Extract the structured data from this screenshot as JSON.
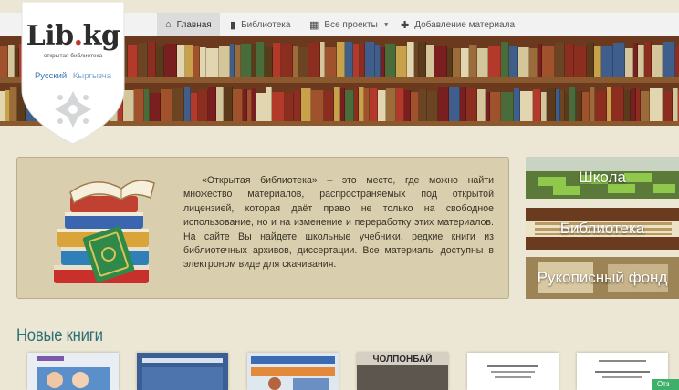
{
  "nav": {
    "home": "Главная",
    "library": "Библиотека",
    "projects": "Все проекты",
    "add": "Добавление материала"
  },
  "logo": {
    "name_a": "Lib",
    "name_dot": ".",
    "name_b": "kg",
    "subtitle": "открытая библиотека",
    "lang_ru": "Русский",
    "lang_ky": "Кыргызча"
  },
  "intro": {
    "text": "«Открытая библиотека» – это место, где можно найти множество материалов, распространяемых под открытой лицензией, которая даёт право не только на свободное использование, но и на изменение и переработку этих материалов. На сайте Вы найдете школьные учебники, редкие книги из библиотечных архивов, диссертации. Все материалы доступны в электроном виде для скачивания."
  },
  "categories": [
    {
      "label": "Школа",
      "bg": "#5b7a3a"
    },
    {
      "label": "Библиотека",
      "bg": "#7b4a2a"
    },
    {
      "label": "Рукописный фонд",
      "bg": "#8a7446"
    }
  ],
  "new_books": {
    "title": "Новые книги",
    "covers": [
      {
        "title": "",
        "color": "#e9eef5"
      },
      {
        "title": "",
        "color": "#3b5f95"
      },
      {
        "title": "",
        "color": "#dfe7ef"
      },
      {
        "title": "ЧОЛПОНБАЙ",
        "color": "#d6cfc4"
      },
      {
        "title": "",
        "color": "#ffffff"
      },
      {
        "title": "",
        "color": "#ffffff"
      }
    ]
  },
  "chat": {
    "label": "Отз"
  },
  "colors": {
    "accent_teal": "#2e6f73",
    "lang_link": "#3a76b5",
    "panel": "#d9cfae",
    "page_bg": "#ece6d4"
  }
}
